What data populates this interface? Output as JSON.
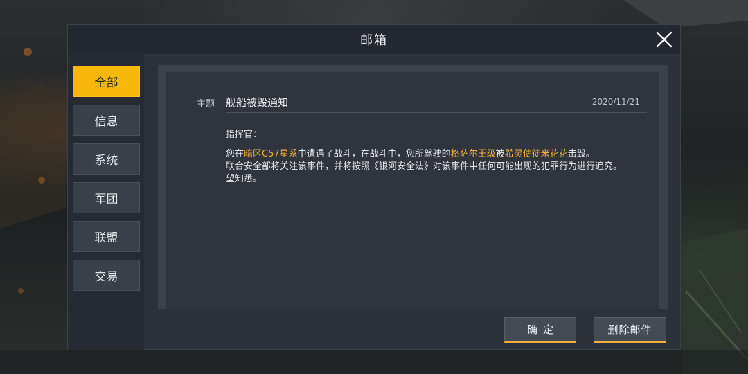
{
  "window": {
    "title": "邮箱"
  },
  "sidebar": {
    "items": [
      {
        "label": "全部",
        "active": true
      },
      {
        "label": "信息",
        "active": false
      },
      {
        "label": "系统",
        "active": false
      },
      {
        "label": "军团",
        "active": false
      },
      {
        "label": "联盟",
        "active": false
      },
      {
        "label": "交易",
        "active": false
      }
    ]
  },
  "mail": {
    "subject_label": "主题",
    "subject": "舰船被毁通知",
    "date": "2020/11/21",
    "greeting": "指挥官：",
    "line1": {
      "p1": "您在",
      "h1": "暗区C57星系",
      "p2": "中遭遇了战斗，在战斗中，您所驾驶的",
      "h2": "格萨尔王级",
      "p3": "被",
      "h3": "希灵使徒米花花",
      "p4": "击毁。"
    },
    "line2": "联合安全部将关注该事件，并将按照《银河安全法》对该事件中任何可能出现的犯罪行为进行追究。",
    "line3": "望知悉。"
  },
  "buttons": {
    "confirm_label": "确定",
    "delete_label": "删除邮件"
  },
  "colors": {
    "accent": "#f5b80b",
    "highlight_text": "#f0b23a",
    "panel": "#2c313a"
  },
  "icons": {
    "close": "close-icon"
  }
}
